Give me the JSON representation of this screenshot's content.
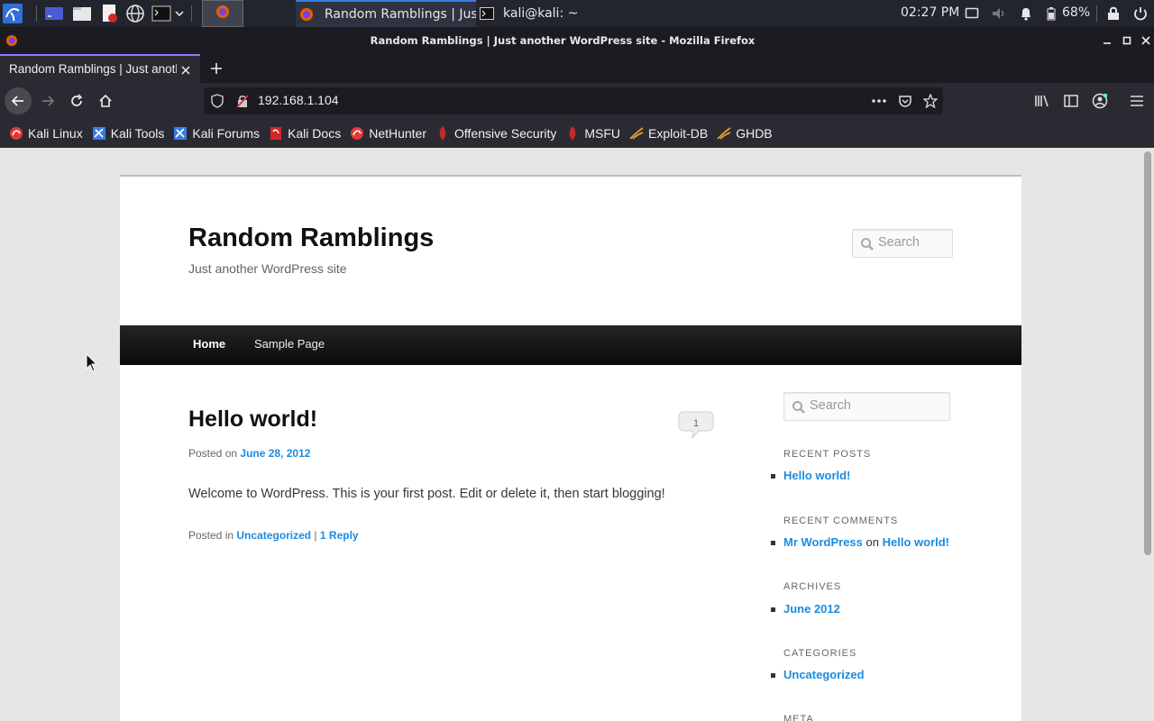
{
  "taskbar": {
    "tasks": [
      {
        "label": "Random Ramblings | Jus..."
      },
      {
        "label": "kali@kali: ~"
      }
    ],
    "clock": "02:27 PM",
    "battery": "68%",
    "icons": [
      "kali-menu-icon",
      "workspace-icon",
      "file-manager-icon",
      "text-editor-icon",
      "browser-icon",
      "terminal-icon",
      "volume-icon",
      "notification-icon",
      "battery-icon",
      "lock-icon",
      "power-icon"
    ]
  },
  "window": {
    "title": "Random Ramblings | Just another WordPress site - Mozilla Firefox"
  },
  "tab": {
    "title": "Random Ramblings | Just another WordPress site"
  },
  "nav": {
    "url": "192.168.1.104"
  },
  "bookmarks": [
    {
      "label": "Kali Linux",
      "color": "#e23a3a"
    },
    {
      "label": "Kali Tools",
      "color": "#3a7be2"
    },
    {
      "label": "Kali Forums",
      "color": "#3a7be2"
    },
    {
      "label": "Kali Docs",
      "color": "#e23a3a"
    },
    {
      "label": "NetHunter",
      "color": "#e23a3a"
    },
    {
      "label": "Offensive Security",
      "color": "#c8282c"
    },
    {
      "label": "MSFU",
      "color": "#c8282c"
    },
    {
      "label": "Exploit-DB",
      "color": "#e0a030"
    },
    {
      "label": "GHDB",
      "color": "#e0a030"
    }
  ],
  "site": {
    "title": "Random Ramblings",
    "description": "Just another WordPress site",
    "search_placeholder": "Search",
    "menu": [
      "Home",
      "Sample Page"
    ]
  },
  "post": {
    "title": "Hello world!",
    "comment_count": "1",
    "posted_on": "Posted on",
    "date": "June 28, 2012",
    "body": "Welcome to WordPress. This is your first post. Edit or delete it, then start blogging!",
    "posted_in": "Posted in",
    "category": "Uncategorized",
    "separator": "|",
    "reply": "1 Reply"
  },
  "sidebar": {
    "search_placeholder": "Search",
    "recent_posts": {
      "title": "RECENT POSTS",
      "items": [
        "Hello world!"
      ]
    },
    "recent_comments": {
      "title": "RECENT COMMENTS",
      "author": "Mr WordPress",
      "on": "on",
      "post": "Hello world!"
    },
    "archives": {
      "title": "ARCHIVES",
      "items": [
        "June 2012"
      ]
    },
    "categories": {
      "title": "CATEGORIES",
      "items": [
        "Uncategorized"
      ]
    },
    "meta": {
      "title": "META"
    }
  },
  "colors": {
    "link": "#1b8be0",
    "accent": "#8b7dff"
  }
}
